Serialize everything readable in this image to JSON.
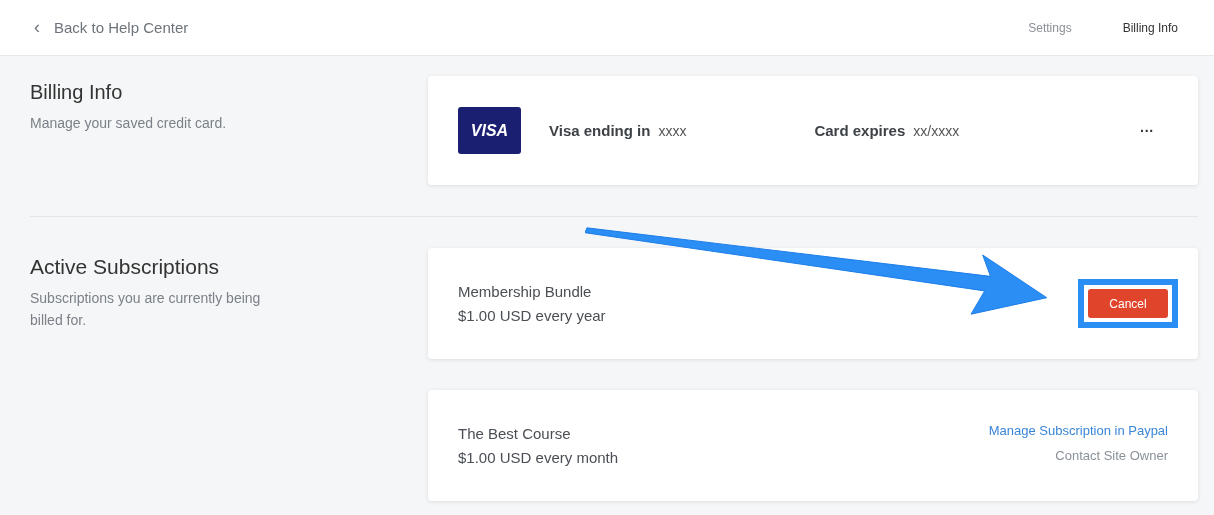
{
  "nav": {
    "back": "Back to Help Center",
    "back_icon": "‹",
    "links": [
      {
        "label": "Settings",
        "selected": false
      },
      {
        "label": "Billing Info",
        "selected": true
      }
    ]
  },
  "billing": {
    "title": "Billing Info",
    "description": "Manage your saved credit card.",
    "card": {
      "brand": "VISA",
      "ending_label": "Visa ending in",
      "ending_value": "xxxx",
      "expires_label": "Card expires",
      "expires_value": "xx/xxxx",
      "menu": "···"
    }
  },
  "subscriptions": {
    "title": "Active Subscriptions",
    "description": "Subscriptions you are currently being billed for.",
    "items": [
      {
        "kind": "cancel",
        "name": "Membership Bundle",
        "price": "$1.00 USD every year",
        "action": "Cancel",
        "highlighted": true
      },
      {
        "kind": "paypal",
        "name": "The Best Course",
        "price": "$1.00 USD every month",
        "action": "Manage Subscription in Paypal",
        "contact": "Contact Site Owner",
        "highlighted": false
      }
    ]
  }
}
